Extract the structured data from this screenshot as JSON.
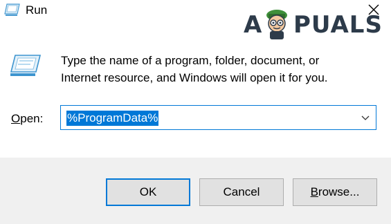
{
  "window": {
    "title": "Run",
    "close_icon": "close-icon",
    "app_icon": "run-icon"
  },
  "watermark": {
    "text_left": "A",
    "text_right": "PUALS"
  },
  "body": {
    "description_line1": "Type the name of a program, folder, document, or",
    "description_line2": "Internet resource, and Windows will open it for you.",
    "open_label_accel": "O",
    "open_label_rest": "pen:",
    "open_value": "%ProgramData%"
  },
  "buttons": {
    "ok": "OK",
    "cancel": "Cancel",
    "browse_accel": "B",
    "browse_rest": "rowse..."
  },
  "colors": {
    "accent": "#0078d7",
    "footer_bg": "#f0f0f0",
    "button_bg": "#e1e1e1",
    "button_border": "#adadad"
  }
}
